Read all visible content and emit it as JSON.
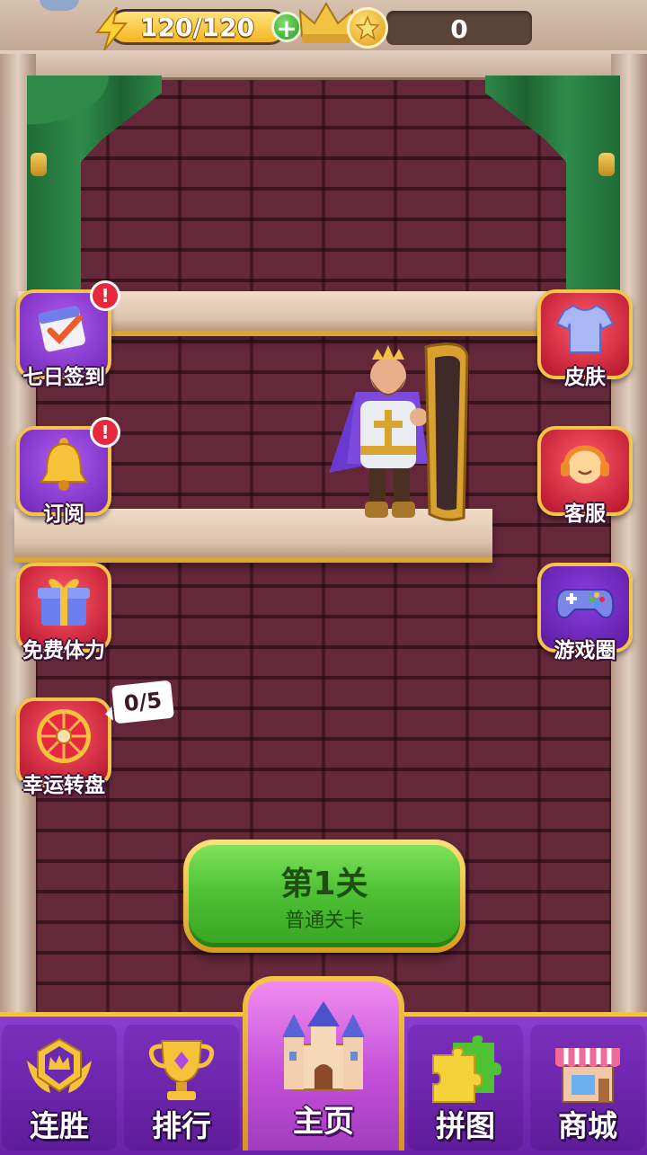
{
  "topbar": {
    "energy": "120/120",
    "energy_level": 1.0,
    "coins": "0"
  },
  "left_buttons": [
    {
      "label": "七日签到",
      "icon": "calendar-check-icon",
      "alert": "!"
    },
    {
      "label": "订阅",
      "icon": "bell-icon",
      "alert": "!"
    },
    {
      "label": "免费体力",
      "icon": "gift-box-icon"
    },
    {
      "label": "幸运转盘",
      "icon": "lucky-wheel-icon",
      "progress": "0/5"
    }
  ],
  "right_buttons": [
    {
      "label": "皮肤",
      "icon": "shirt-icon"
    },
    {
      "label": "客服",
      "icon": "headset-agent-icon"
    },
    {
      "label": "游戏圈",
      "icon": "gamepad-icon"
    }
  ],
  "play": {
    "title": "第1关",
    "subtitle": "普通关卡"
  },
  "nav": {
    "streak": "连胜",
    "rank": "排行",
    "home": "主页",
    "puzzle": "拼图",
    "shop": "商城"
  },
  "colors": {
    "accent_gold": "#f6c448",
    "nav_purple": "#7b2fbd",
    "play_green": "#4fc234",
    "alert_red": "#e8283c"
  }
}
